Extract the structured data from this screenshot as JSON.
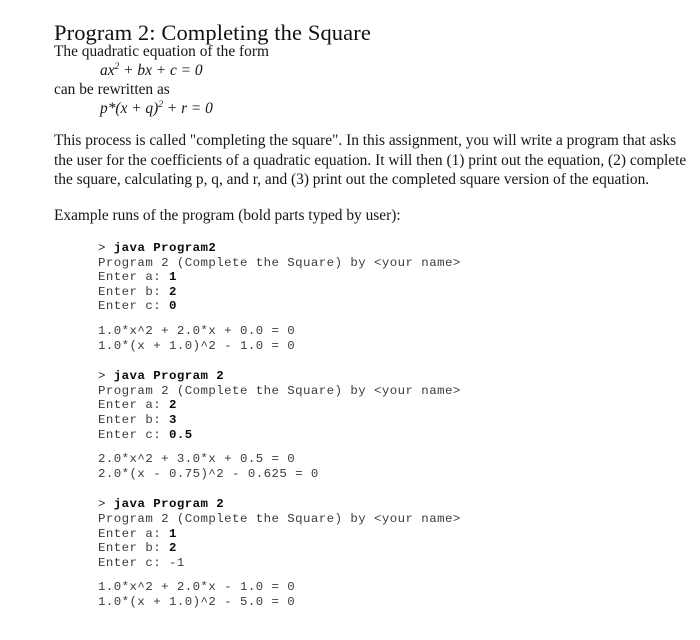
{
  "document": {
    "title": "Program 2: Completing the Square",
    "intro": {
      "line1": "The quadratic equation of the form",
      "equation1_prefix": "ax",
      "equation1_sup": "2",
      "equation1_rest": " + bx + c = 0",
      "line2": "can be rewritten as",
      "equation2_prefix": "p*(x + q)",
      "equation2_sup": "2",
      "equation2_rest": " + r = 0"
    },
    "paragraph": {
      "line1": "This process is called \"completing the square\".  In this assignment, you will write a program that asks",
      "line2": "the user for the coefficients of a quadratic equation.  It will then (1) print out the equation, (2) complete",
      "line3": "the square, calculating p, q, and r, and (3) print out the completed square version of the  equation."
    },
    "example_lead": "Example runs of the program (bold parts typed by user):",
    "runs": [
      {
        "prompt": "> ",
        "command": "java Program2",
        "banner": "Program 2 (Complete the Square) by <your name>",
        "prompts": [
          {
            "label": "Enter a: ",
            "value": "1",
            "bold": true
          },
          {
            "label": "Enter b: ",
            "value": "2",
            "bold": true
          },
          {
            "label": "Enter c: ",
            "value": "0",
            "bold": true
          }
        ],
        "output": [
          "1.0*x^2 + 2.0*x + 0.0 = 0",
          "1.0*(x + 1.0)^2 - 1.0 = 0"
        ]
      },
      {
        "prompt": "> ",
        "command": "java Program 2",
        "banner": "Program 2 (Complete the Square) by <your name>",
        "prompts": [
          {
            "label": "Enter a: ",
            "value": "2",
            "bold": true
          },
          {
            "label": "Enter b: ",
            "value": "3",
            "bold": true
          },
          {
            "label": "Enter c: ",
            "value": "0.5",
            "bold": true
          }
        ],
        "output": [
          "2.0*x^2 + 3.0*x + 0.5 = 0",
          "2.0*(x - 0.75)^2 - 0.625 = 0"
        ]
      },
      {
        "prompt": "> ",
        "command": "java Program 2",
        "banner": "Program 2 (Complete the Square) by <your name>",
        "prompts": [
          {
            "label": "Enter a: ",
            "value": "1",
            "bold": true
          },
          {
            "label": "Enter b: ",
            "value": "2",
            "bold": true
          },
          {
            "label": "Enter c: ",
            "value": "-1",
            "bold": false
          }
        ],
        "output": [
          "1.0*x^2 + 2.0*x - 1.0 = 0",
          "1.0*(x + 1.0)^2 - 5.0 = 0"
        ]
      }
    ]
  },
  "colors": {
    "page_background": "#ffffff",
    "body_text": "#151515",
    "code_text": "#3b3b3b",
    "code_user_input": "#0b0b0b"
  }
}
